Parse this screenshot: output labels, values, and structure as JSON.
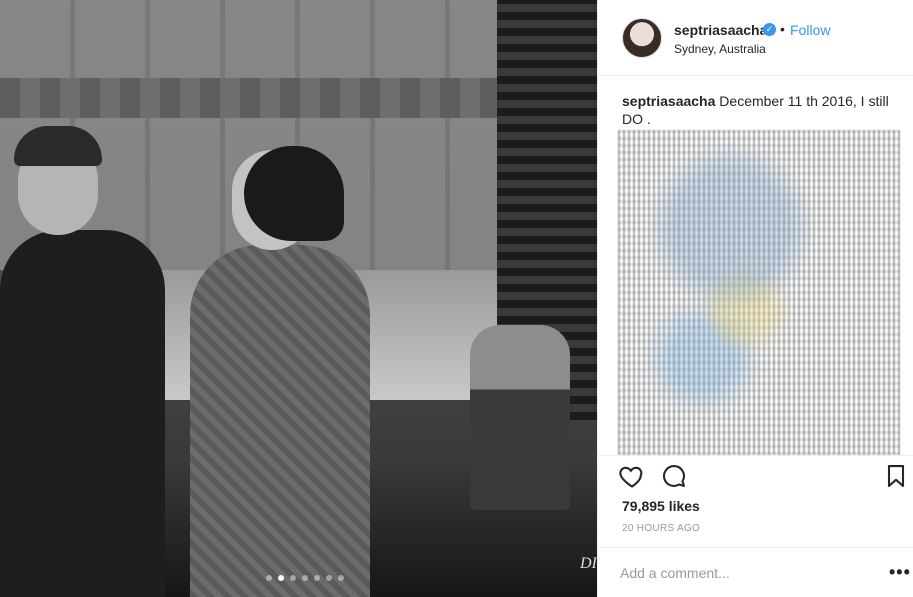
{
  "post": {
    "username": "septriasaacha",
    "verified_icon": "verified-badge-icon",
    "separator": "•",
    "follow_label": "Follow",
    "location": "Sydney, Australia",
    "caption_text": "December 11 th 2016, I still DO .",
    "likes": "79,895 likes",
    "time": "20 HOURS AGO"
  },
  "photo": {
    "watermark": "DI",
    "carousel_dot_count": 7,
    "carousel_active_index": 1
  },
  "comment_box": {
    "placeholder": "Add a comment...",
    "more_label": "•••"
  },
  "colors": {
    "link_blue": "#3897f0",
    "text": "#262626",
    "muted": "#999999"
  },
  "icons": {
    "like": "heart-icon",
    "comment": "comment-icon",
    "save": "bookmark-icon",
    "options": "more-options-icon"
  }
}
